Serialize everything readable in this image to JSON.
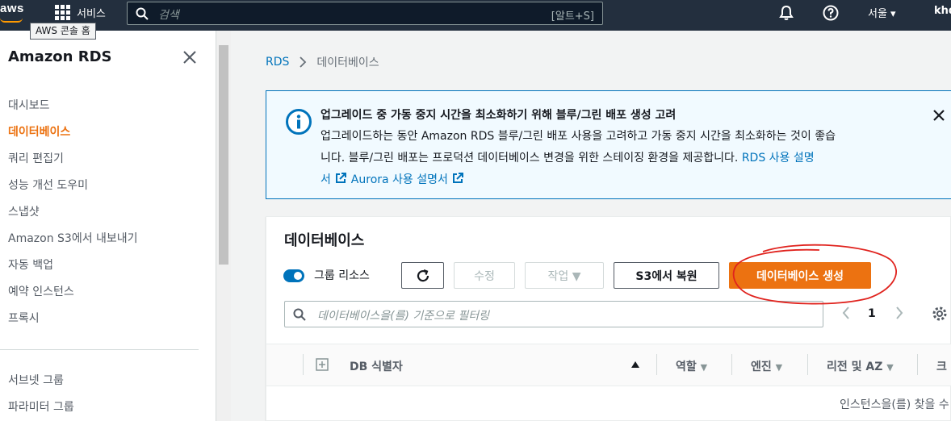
{
  "topnav": {
    "logo": "aws",
    "services_label": "서비스",
    "tooltip": "AWS 콘솔 홈",
    "search_placeholder": "검색",
    "search_shortcut": "[알트+S]",
    "region": "서울 ▾",
    "user": "khd"
  },
  "sidebar": {
    "title": "Amazon RDS",
    "items": [
      {
        "label": "대시보드"
      },
      {
        "label": "데이터베이스",
        "active": true
      },
      {
        "label": "쿼리 편집기"
      },
      {
        "label": "성능 개선 도우미"
      },
      {
        "label": "스냅샷"
      },
      {
        "label": "Amazon S3에서 내보내기"
      },
      {
        "label": "자동 백업"
      },
      {
        "label": "예약 인스턴스"
      },
      {
        "label": "프록시"
      }
    ],
    "items2": [
      {
        "label": "서브넷 그룹"
      },
      {
        "label": "파라미터 그룹"
      }
    ]
  },
  "breadcrumb": {
    "root": "RDS",
    "current": "데이터베이스"
  },
  "flash": {
    "title": "업그레이드 중 가동 중지 시간을 최소화하기 위해 블루/그린 배포 생성 고려",
    "line1": "업그레이드하는 동안 Amazon RDS 블루/그린 배포 사용을 고려하고 가동 중지 시간을 최소화하는 것이 좋습",
    "line2": "니다. 블루/그린 배포는 프로덕션 데이터베이스 변경을 위한 스테이징 환경을 제공합니다. ",
    "link1_a": "RDS 사용 설명",
    "link1_b": "서",
    "link2": "Aurora 사용 설명서"
  },
  "panel": {
    "title": "데이터베이스",
    "toggle_label": "그룹 리소스",
    "btn_modify": "수정",
    "btn_actions": "작업 ▼",
    "btn_restore": "S3에서 복원",
    "btn_create": "데이터베이스 생성",
    "filter_placeholder": "데이터베이스을(를) 기준으로 필터링",
    "page": "1",
    "columns": {
      "db_id": "DB 식별자",
      "role": "역할",
      "engine": "엔진",
      "region_az": "리전 및 AZ",
      "size": "크"
    },
    "empty_text": "인스턴스을(를) 찾을 수"
  },
  "colors": {
    "nav_bg": "#232f3e",
    "accent_orange": "#ec7211",
    "link_blue": "#0073bb",
    "annotation_red": "#e0231e"
  }
}
